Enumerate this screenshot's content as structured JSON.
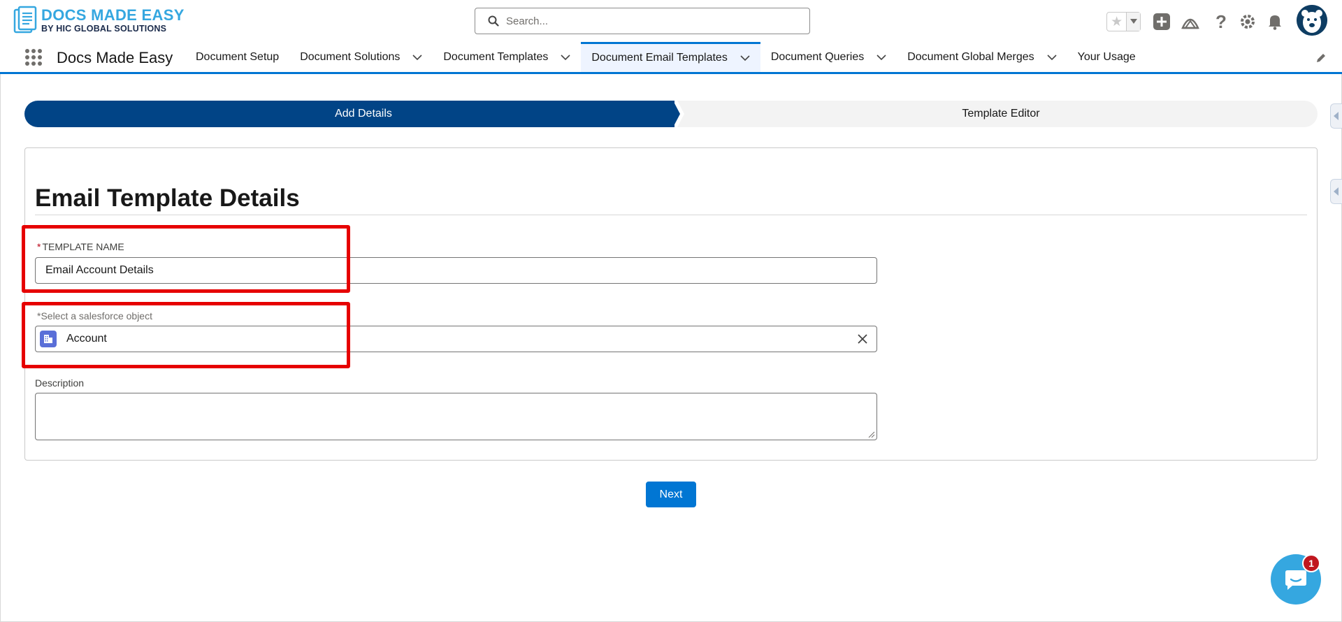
{
  "header": {
    "logo_main": "DOCS MADE EASY",
    "logo_sub": "BY HIC GLOBAL SOLUTIONS",
    "search_placeholder": "Search...",
    "icons": [
      "star-icon",
      "chevron-down-icon",
      "add-icon",
      "trailhead-icon",
      "help-icon",
      "gear-icon",
      "bell-icon",
      "avatar"
    ]
  },
  "nav": {
    "app_name": "Docs Made Easy",
    "items": [
      {
        "label": "Document Setup",
        "dropdown": false,
        "active": false
      },
      {
        "label": "Document Solutions",
        "dropdown": true,
        "active": false
      },
      {
        "label": "Document Templates",
        "dropdown": true,
        "active": false
      },
      {
        "label": "Document Email Templates",
        "dropdown": true,
        "active": true
      },
      {
        "label": "Document Queries",
        "dropdown": true,
        "active": false
      },
      {
        "label": "Document Global Merges",
        "dropdown": true,
        "active": false
      },
      {
        "label": "Your Usage",
        "dropdown": false,
        "active": false
      }
    ]
  },
  "path": {
    "step1": "Add Details",
    "step2": "Template Editor"
  },
  "form": {
    "title": "Email Template Details",
    "template_name_label": "TEMPLATE NAME",
    "template_name_required": "*",
    "template_name_value": "Email Account Details",
    "object_label": "*Select a salesforce object",
    "object_value": "Account",
    "description_label": "Description",
    "description_value": ""
  },
  "actions": {
    "next_label": "Next"
  },
  "chat": {
    "badge_count": "1"
  },
  "colors": {
    "brand_blue": "#0176d3",
    "path_active": "#014486",
    "highlight": "#e60000",
    "logo_blue": "#35a7e0"
  }
}
